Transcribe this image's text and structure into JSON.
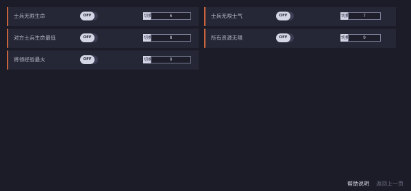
{
  "toggle_text": "OFF",
  "hotkey_tag": "切换",
  "cheats_left": [
    {
      "label": "士兵无限生命",
      "key": "6"
    },
    {
      "label": "对方士兵生命最低",
      "key": "8"
    },
    {
      "label": "将领经验最大",
      "key": "0"
    }
  ],
  "cheats_right": [
    {
      "label": "士兵无限士气",
      "key": "7"
    },
    {
      "label": "所有资源无限",
      "key": "9"
    }
  ],
  "footer": {
    "help": "帮助说明",
    "back": "返回上一页"
  },
  "colors": {
    "accent": "#c8643c",
    "panel": "#262736",
    "background": "#1b1c27"
  }
}
